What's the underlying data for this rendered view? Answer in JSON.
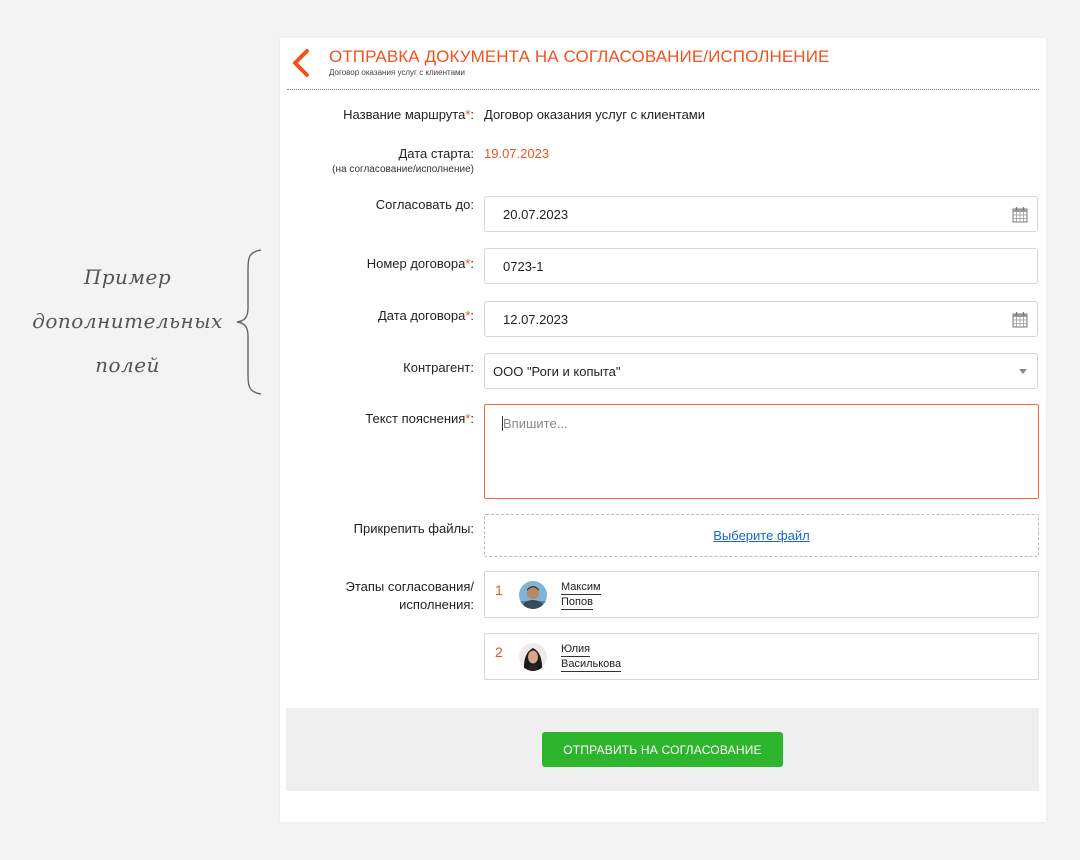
{
  "annotation": {
    "lines": [
      "Пример",
      "дополнительных",
      "полей"
    ]
  },
  "header": {
    "title": "ОТПРАВКА ДОКУМЕНТА НА СОГЛАСОВАНИЕ/ИСПОЛНЕНИЕ",
    "subtitle": "Договор оказания услуг с клиентами"
  },
  "form": {
    "route": {
      "label": "Название маршрута",
      "value": "Договор оказания услуг с клиентами"
    },
    "start_date": {
      "label": "Дата старта:",
      "sublabel": "(на согласование/исполнение)",
      "value": "19.07.2023"
    },
    "approve_until": {
      "label": "Согласовать до:",
      "value": "20.07.2023"
    },
    "contract_number": {
      "label": "Номер договора",
      "value": "0723-1"
    },
    "contract_date": {
      "label": "Дата договора",
      "value": "12.07.2023"
    },
    "counterparty": {
      "label": "Контрагент:",
      "value": "ООО \"Роги и копыта\""
    },
    "explanation": {
      "label": "Текст пояснения",
      "placeholder": "Впишите..."
    },
    "attach": {
      "label": "Прикрепить файлы:",
      "link": "Выберите файл"
    },
    "stages": {
      "label_line1": "Этапы согласования/",
      "label_line2": "исполнения:",
      "items": [
        {
          "number": "1",
          "first_name": "Максим",
          "last_name": "Попов"
        },
        {
          "number": "2",
          "first_name": "Юлия",
          "last_name": "Василькова"
        }
      ]
    },
    "required_marker": "*",
    "colon": ":"
  },
  "submit": {
    "label": "ОТПРАВИТЬ НА СОГЛАСОВАНИЕ"
  },
  "colors": {
    "accent": "#f4511e",
    "submit_green": "#2db52d",
    "link": "#1a66c9",
    "background": "#f3f3f3"
  },
  "icons": [
    "chevron-left-icon",
    "calendar-icon",
    "dropdown-caret-icon",
    "curly-brace-icon"
  ]
}
